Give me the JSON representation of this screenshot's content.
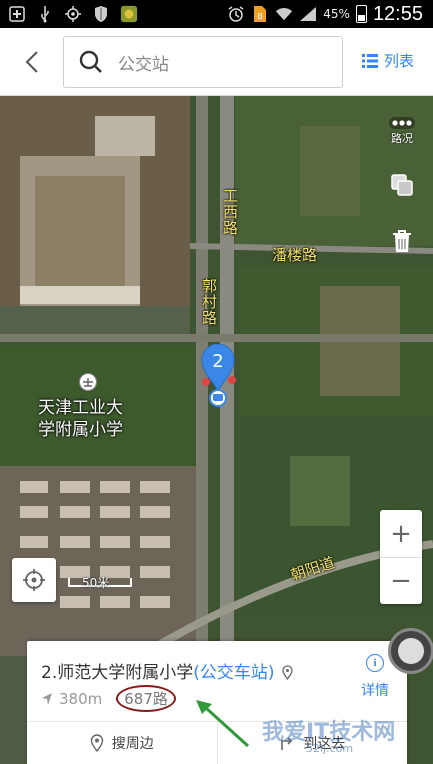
{
  "status_bar": {
    "battery_pct": "45%",
    "time": "12:55",
    "icons": [
      "add-icon",
      "usb-icon",
      "gps-icon",
      "shield-icon",
      "app-icon",
      "alarm-icon",
      "sim-icon",
      "wifi-icon",
      "signal-icon"
    ]
  },
  "header": {
    "search_placeholder": "公交站",
    "list_label": "列表"
  },
  "map": {
    "tools": {
      "traffic_label": "路况"
    },
    "roads": {
      "gongxi": "工西路",
      "panlou": "潘楼路",
      "guocun": "郭村路",
      "chaoyang": "朝阳道"
    },
    "poi": {
      "line1": "天津工业大",
      "line2": "学附属小学"
    },
    "marker_number": "2",
    "scale_label": "50米",
    "zoom_in": "+",
    "zoom_out": "−"
  },
  "card": {
    "title": "2.师范大学附属小学",
    "tag": "(公交车站)",
    "distance": "380m",
    "route": "687路",
    "detail_label": "详情",
    "action_nearby": "搜周边",
    "action_goto": "到这去"
  },
  "watermark": {
    "main": "我爱IT技术网",
    "sub": "52ij.com"
  },
  "colors": {
    "accent": "#3385ff",
    "marker": "#3a87e8",
    "road_label": "#f2e36a"
  }
}
